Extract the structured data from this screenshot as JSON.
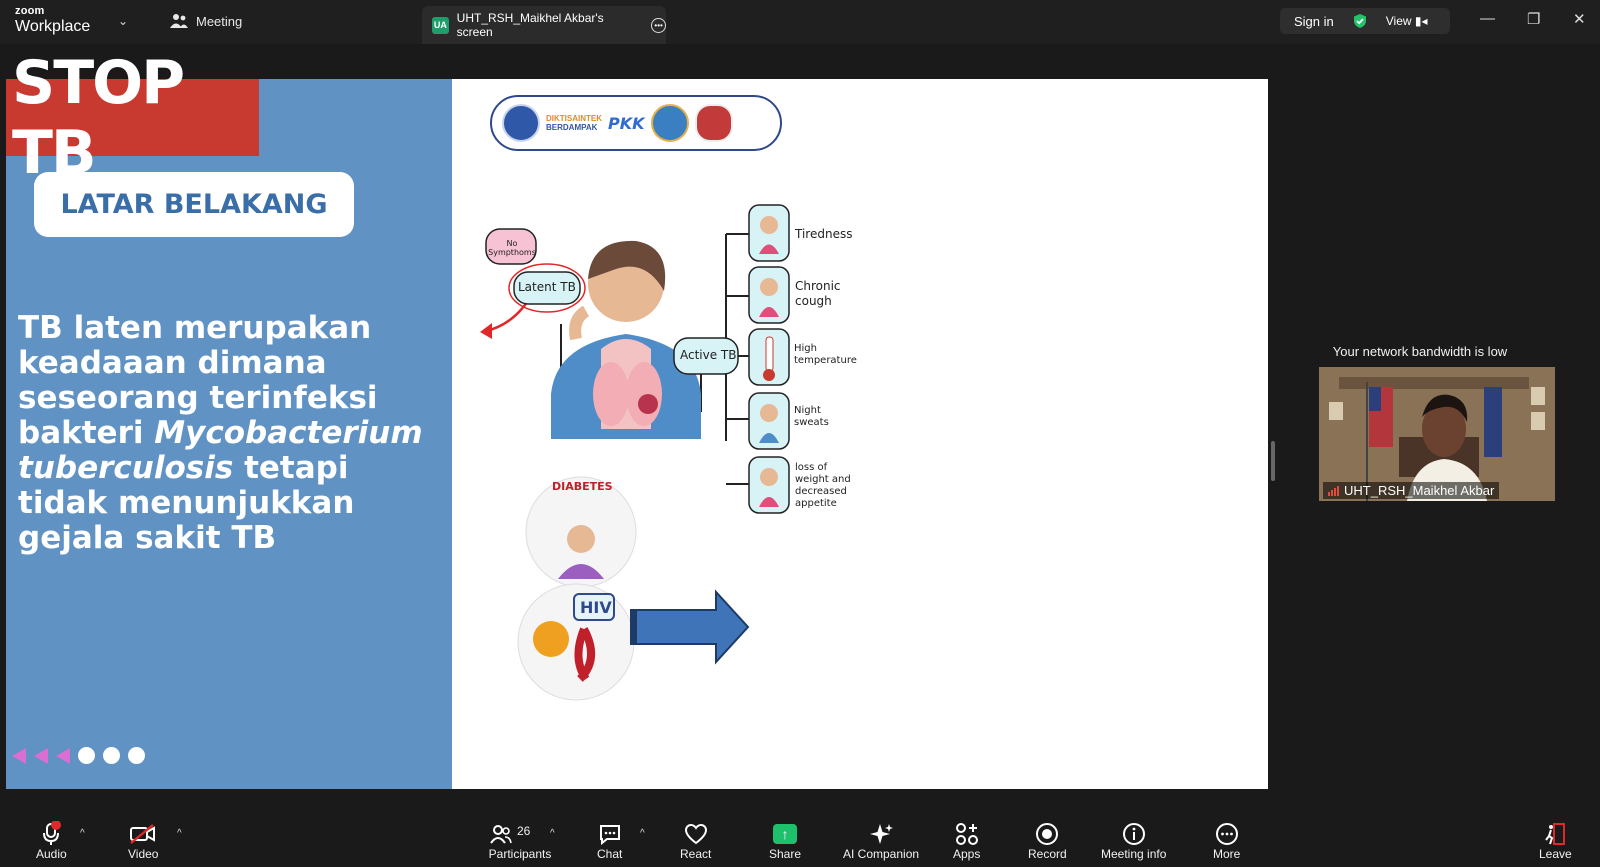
{
  "topbar": {
    "brand_small": "zoom",
    "brand_big": "Workplace",
    "meeting_label": "Meeting",
    "share_tab_badge": "UA",
    "share_tab_label": "UHT_RSH_Maikhel Akbar's screen",
    "sign_in": "Sign in",
    "view": "View"
  },
  "slide": {
    "stop_tb": "STOP TB",
    "heading": "LATAR BELAKANG",
    "body_1": "TB laten merupakan keadaaan dimana seseorang terinfeksi bakteri ",
    "body_italic": "Mycobacterium tuberculosis",
    "body_2": " tetapi tidak menunjukkan gejala sakit TB",
    "logo_text_1": "DIKTISAINTEK",
    "logo_text_2": "BERDAMPAK",
    "logo_pkk": "PKK",
    "diagram": {
      "no_symptoms": "No Sympthoms",
      "latent": "Latent TB",
      "active": "Active TB",
      "symptoms": [
        "Tiredness",
        "Chronic cough",
        "High temperature",
        "Night sweats",
        "loss of weight and decreased appetite"
      ],
      "diabetes": "DIABETES",
      "hiv": "HIV"
    }
  },
  "participant": {
    "bandwidth_msg": "Your network bandwidth is low",
    "name": "UHT_RSH_Maikhel Akbar"
  },
  "toolbar": {
    "audio": "Audio",
    "video": "Video",
    "participants": "Participants",
    "participant_count": "26",
    "chat": "Chat",
    "react": "React",
    "share": "Share",
    "ai_companion": "AI Companion",
    "apps": "Apps",
    "record": "Record",
    "meeting_info": "Meeting info",
    "more": "More",
    "leave": "Leave"
  },
  "colors": {
    "slide_blue": "#6092c4",
    "stop_red": "#c83a2f",
    "share_green": "#1fc06b"
  }
}
